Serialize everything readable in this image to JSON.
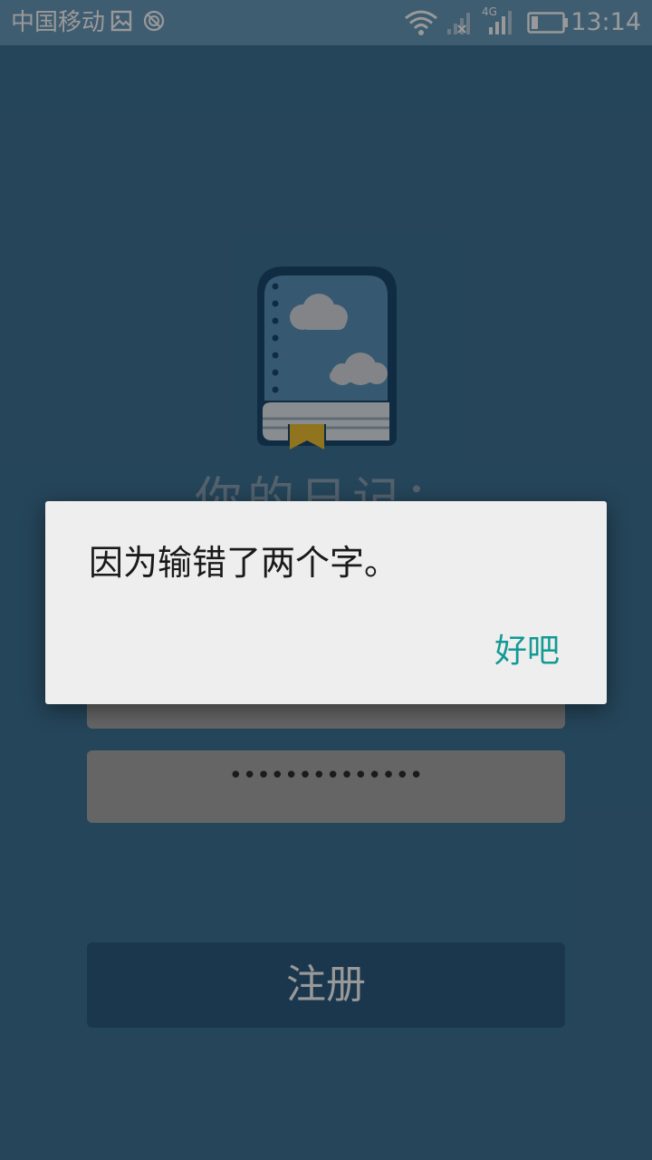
{
  "status_bar": {
    "carrier": "中国移动",
    "network_type": "4G",
    "time": "13:14",
    "icons": [
      "image-notification-icon",
      "sync-disabled-icon",
      "wifi-icon",
      "signal-x-icon",
      "signal-4g-icon",
      "battery-icon"
    ]
  },
  "app": {
    "title": "你的日记：",
    "password_mask": "••••••••••••••",
    "register_label": "注册"
  },
  "dialog": {
    "message": "因为输错了两个字。",
    "ok_label": "好吧"
  },
  "colors": {
    "background": "#3f7396",
    "status_bar": "#6a9bbd",
    "accent": "#139a94",
    "dialog_bg": "#eeeeee"
  }
}
